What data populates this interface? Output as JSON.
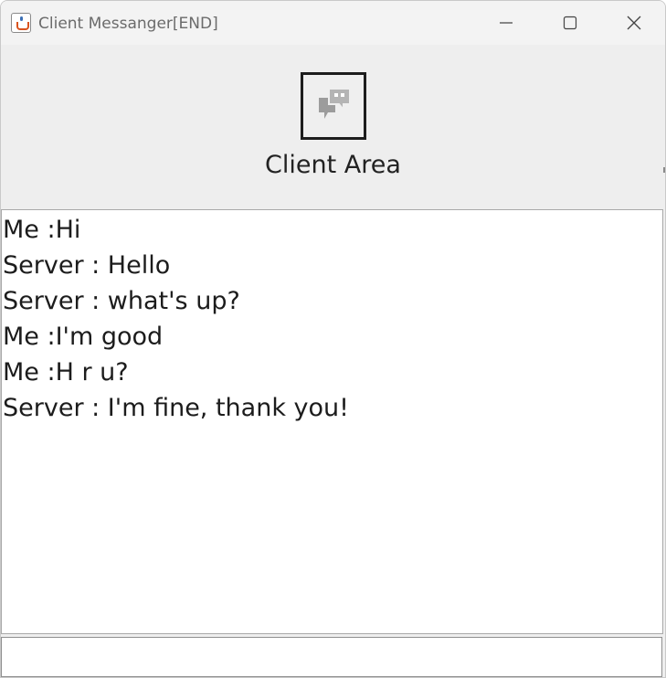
{
  "window": {
    "title": "Client Messanger[END]",
    "controls": {
      "minimize_icon": "minimize-icon",
      "maximize_icon": "maximize-icon",
      "close_icon": "close-icon"
    }
  },
  "header": {
    "logo_icon": "chat-bubbles-icon",
    "title": "Client Area"
  },
  "chat": {
    "messages": [
      "Me :Hi",
      "Server : Hello",
      "Server : what's up?",
      "Me :I'm good",
      "Me :H r u?",
      "Server : I'm fine, thank you!"
    ]
  },
  "input": {
    "value": ""
  },
  "colors": {
    "titlebar_bg": "#f3f3f3",
    "panel_bg": "#eeeeee",
    "chat_bg": "#ffffff",
    "text": "#1c1c1c"
  }
}
